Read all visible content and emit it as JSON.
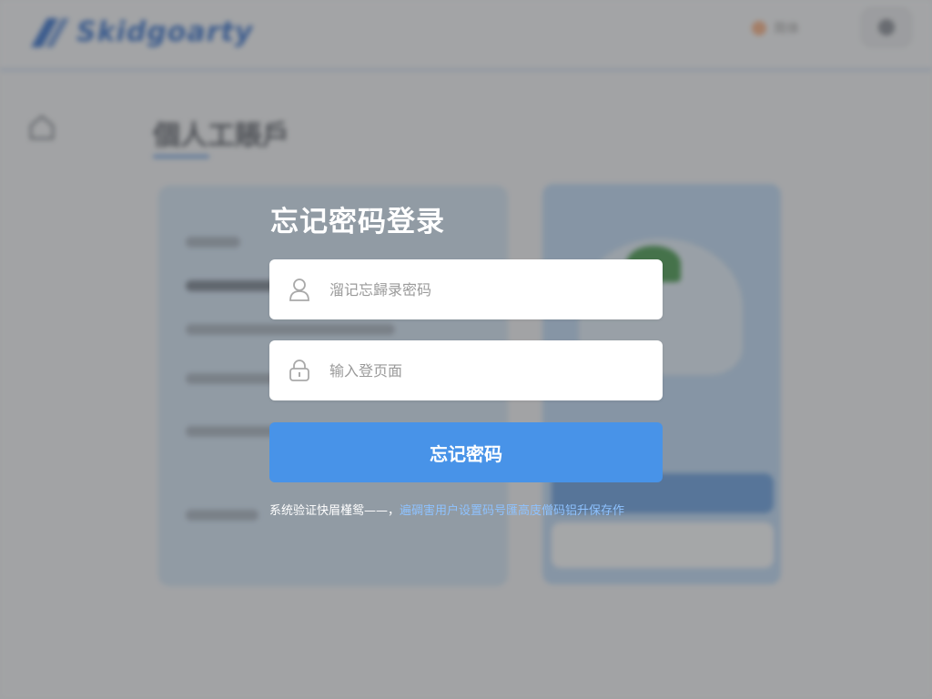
{
  "background": {
    "logo_text": "Skidgoarty",
    "language_label": "简体",
    "page_title": "個人工賬戶"
  },
  "login": {
    "title": "忘记密码登录",
    "username_placeholder": "溜记忘歸录密码",
    "password_placeholder": "输入登页面",
    "submit_label": "忘记密码",
    "hint_text": "系统验证快眉槿鸳——，",
    "hint_link": "遍碉害用户设置码号匯高庋僧码铝升保存作"
  },
  "icons": {
    "username": "user-icon",
    "password": "lock-icon",
    "home": "home-icon",
    "logo": "logo-mark-icon"
  },
  "colors": {
    "accent": "#4893e8",
    "link": "#8ec2ff",
    "overlay": "#3c3c3c"
  }
}
